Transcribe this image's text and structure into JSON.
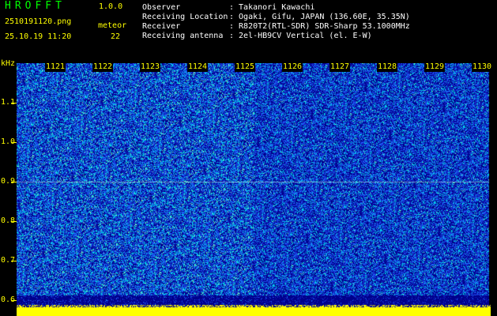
{
  "header": {
    "brand": "HROFFT",
    "version": "1.0.0",
    "filename": "2510191120.png",
    "timestamp": "25.10.19 11:20",
    "mode_label": "meteor",
    "count": "22"
  },
  "info": [
    {
      "label": "Observer",
      "value": ": Takanori Kawachi"
    },
    {
      "label": "Receiving Location",
      "value": ": Ogaki, Gifu, JAPAN (136.60E, 35.35N)"
    },
    {
      "label": "Receiver",
      "value": ": R820T2(RTL-SDR) SDR-Sharp 53.1000MHz"
    },
    {
      "label": "Receiving antenna",
      "value": ": 2el-HB9CV Vertical (el. E-W)"
    }
  ],
  "spectrogram": {
    "y_unit": "kHz",
    "y_ticks": [
      "1.1",
      "1.0",
      "0.9",
      "0.8",
      "0.7",
      "0.6"
    ],
    "top_ticks": [
      "1121",
      "1122",
      "1123",
      "1124",
      "1125",
      "1126",
      "1127",
      "1128",
      "1129",
      "1130"
    ],
    "colors": {
      "background": "#00008b",
      "mid": "#1e64ff",
      "high": "#00e5e5",
      "peak": "#ffff00"
    }
  }
}
